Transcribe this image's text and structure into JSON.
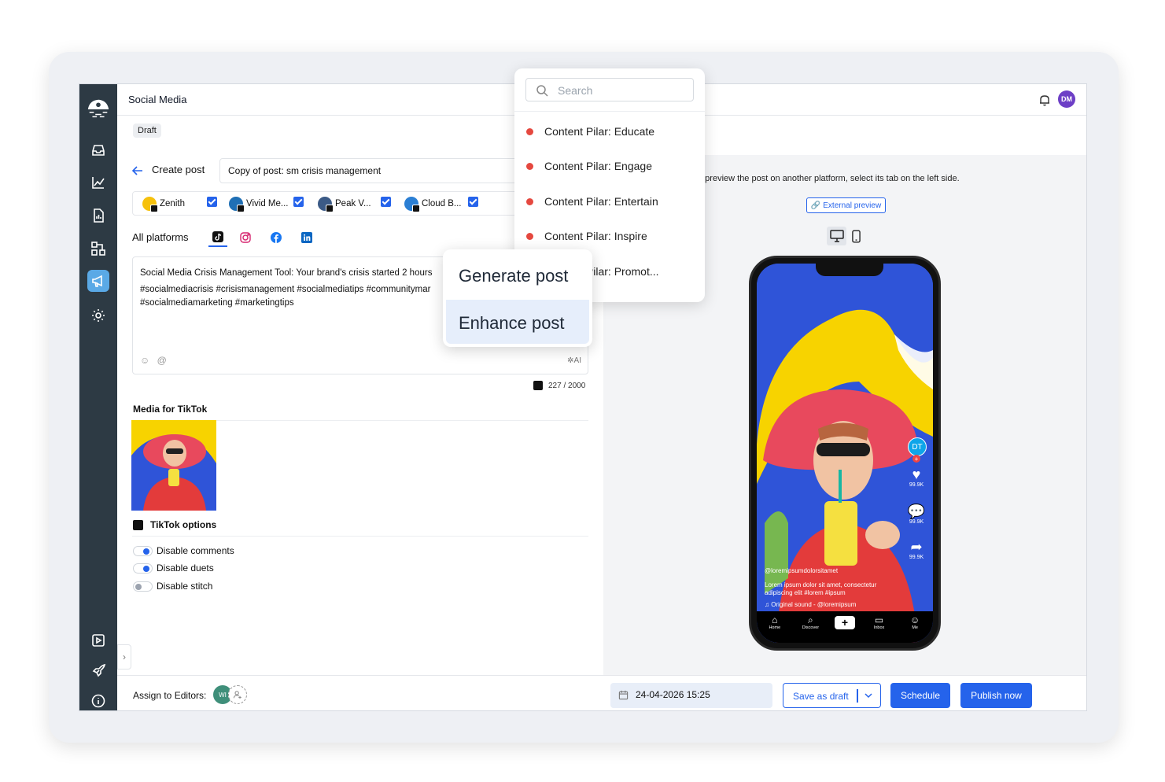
{
  "app": {
    "title": "Social Media",
    "user_initials": "DM"
  },
  "status": {
    "draft_label": "Draft"
  },
  "create": {
    "label": "Create post",
    "post_name": "Copy of post: sm crisis management"
  },
  "accounts": [
    {
      "name": "Zenith",
      "color": "#f6c10c"
    },
    {
      "name": "Vivid Me...",
      "color": "#1f6fb5"
    },
    {
      "name": "Peak V...",
      "color": "#3b5a86"
    },
    {
      "name": "Cloud B...",
      "color": "#2b7fd4"
    }
  ],
  "tabs": {
    "all": "All platforms"
  },
  "editor": {
    "line1": "Social Media Crisis Management Tool: Your brand's crisis started 2 hours",
    "line2": "#socialmediacrisis #crisismanagement #socialmediatips #communitymar",
    "line3": "#socialmediamarketing #marketingtips",
    "ai_label": "AI",
    "counter": "227 / 2000"
  },
  "media": {
    "label": "Media for TikTok"
  },
  "tiktok_options": {
    "label": "TikTok options",
    "toggles": [
      {
        "label": "Disable comments",
        "state": "on"
      },
      {
        "label": "Disable duets",
        "state": "on"
      },
      {
        "label": "Disable stitch",
        "state": "off"
      }
    ]
  },
  "footer": {
    "assign_label": "Assign to Editors:",
    "editor_initials": "WI",
    "date": "24-04-2026 15:25",
    "save_draft": "Save as draft",
    "schedule": "Schedule",
    "publish": "Publish now"
  },
  "preview": {
    "note": "o preview the post on another platform, select its tab on the left side.",
    "external": "External preview",
    "creator_initials": "DT",
    "likes": "99.9K",
    "comments": "99.9K",
    "shares": "99.9K",
    "handle": "@loremipsumdolorsitamet",
    "caption1": "Lorem ipsum dolor sit amet, consectetur",
    "caption2": "adipiscing elit #lorem #ipsum",
    "sound": "Original sound - @loremipsum",
    "nav": [
      "Home",
      "Discover",
      "Inbox",
      "Me"
    ]
  },
  "dropdown": {
    "search_placeholder": "Search",
    "items": [
      "Content Pilar: Educate",
      "Content Pilar: Engage",
      "Content Pilar: Entertain",
      "Content Pilar: Inspire",
      "Content Pilar: Promot..."
    ]
  },
  "ai_menu": {
    "generate": "Generate post",
    "enhance": "Enhance post"
  }
}
